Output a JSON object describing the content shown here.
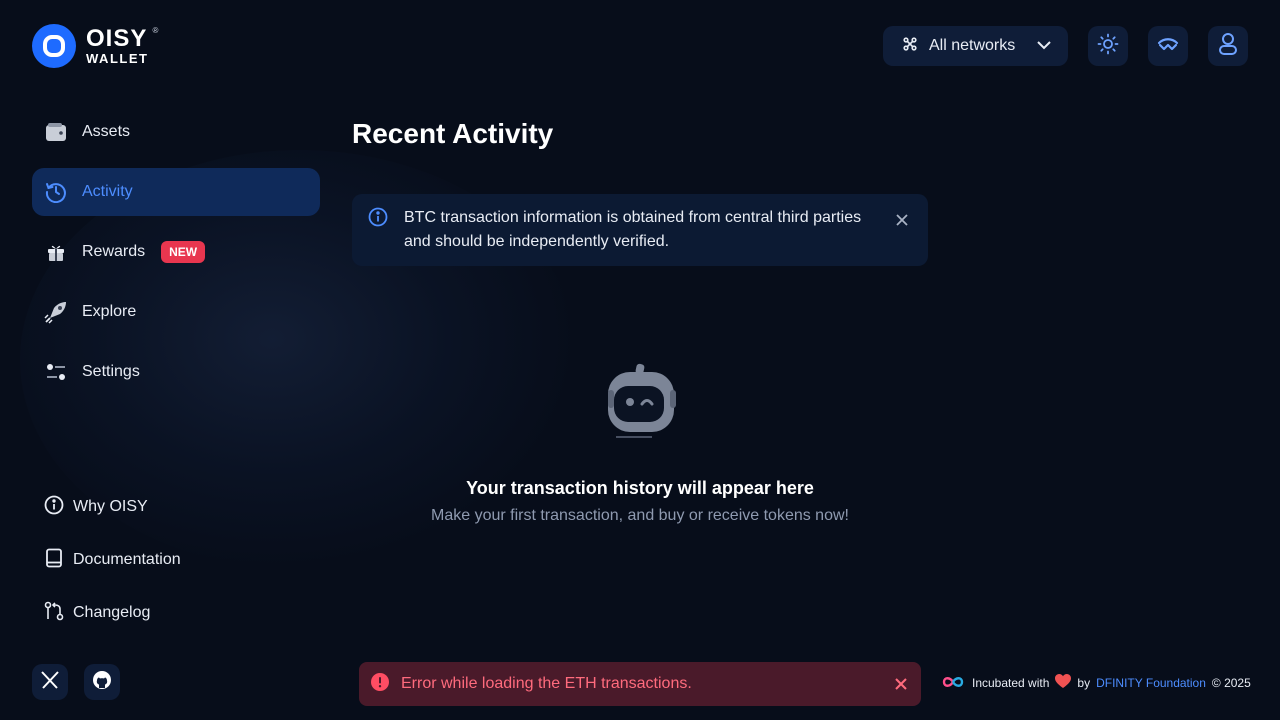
{
  "brand": {
    "line1": "OISY",
    "line2": "WALLET",
    "registered": "®"
  },
  "header": {
    "network_label": "All networks"
  },
  "sidebar": {
    "items": [
      {
        "label": "Assets"
      },
      {
        "label": "Activity"
      },
      {
        "label": "Rewards",
        "badge": "NEW"
      },
      {
        "label": "Explore"
      },
      {
        "label": "Settings"
      }
    ],
    "links": [
      {
        "label": "Why OISY"
      },
      {
        "label": "Documentation"
      },
      {
        "label": "Changelog"
      }
    ]
  },
  "main": {
    "title": "Recent Activity",
    "info_banner": "BTC transaction information is obtained from central third parties and should be independently verified.",
    "empty_title": "Your transaction history will appear here",
    "empty_subtitle": "Make your first transaction, and buy or receive tokens now!"
  },
  "error_toast": {
    "message": "Error while loading the ETH transactions."
  },
  "footer": {
    "incubated": "Incubated with",
    "by": "by",
    "foundation": "DFINITY Foundation",
    "copyright": "© 2025"
  },
  "colors": {
    "accent": "#4d8dff",
    "brand_blue": "#1e6bff",
    "badge": "#e8364f",
    "error": "#ff6b7d",
    "background": "#070d1a"
  }
}
